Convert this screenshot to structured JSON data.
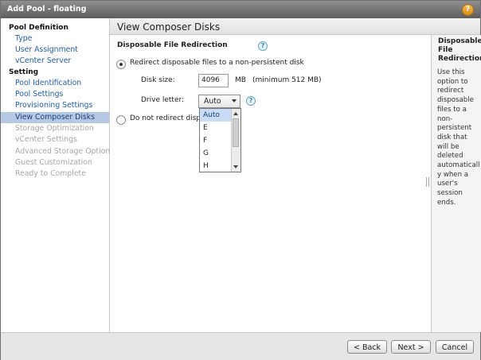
{
  "window": {
    "title": "Add Pool - floating",
    "help_glyph": "?"
  },
  "sidebar": {
    "sections": [
      {
        "heading": "Pool Definition",
        "items": [
          {
            "label": "Type",
            "state": "link"
          },
          {
            "label": "User Assignment",
            "state": "link"
          },
          {
            "label": "vCenter Server",
            "state": "link"
          }
        ]
      },
      {
        "heading": "Setting",
        "items": [
          {
            "label": "Pool Identification",
            "state": "link"
          },
          {
            "label": "Pool Settings",
            "state": "link"
          },
          {
            "label": "Provisioning Settings",
            "state": "link"
          },
          {
            "label": "View Composer Disks",
            "state": "selected"
          },
          {
            "label": "Storage Optimization",
            "state": "disabled"
          },
          {
            "label": "vCenter Settings",
            "state": "disabled"
          },
          {
            "label": "Advanced Storage Options",
            "state": "disabled"
          },
          {
            "label": "Guest Customization",
            "state": "disabled"
          },
          {
            "label": "Ready to Complete",
            "state": "disabled"
          }
        ]
      }
    ]
  },
  "main": {
    "page_title": "View Composer Disks",
    "section_heading": "Disposable File Redirection",
    "help_glyph": "?",
    "redirect_option": {
      "label": "Redirect disposable files to a non-persistent disk",
      "selected": true,
      "disk_size_label": "Disk size:",
      "disk_size_value": "4096",
      "disk_size_unit": "MB",
      "disk_size_min": "(minimum 512 MB)",
      "drive_letter_label": "Drive letter:",
      "drive_letter_value": "Auto",
      "drive_letter_options": [
        "Auto",
        "E",
        "F",
        "G",
        "H"
      ]
    },
    "no_redirect_option": {
      "label": "Do not redirect disposable files",
      "visible_label": "Do not redirect dispo",
      "selected": false
    }
  },
  "help_panel": {
    "title": "Disposable File Redirection",
    "body": "Use this option to redirect disposable files to a non-persistent disk that will be deleted automatically when a user's session ends."
  },
  "footer": {
    "back_label": "< Back",
    "next_label": "Next >",
    "cancel_label": "Cancel"
  },
  "colors": {
    "titlebar": "#6e6e6e",
    "link": "#1f5fb3",
    "disabled": "#a8a8a8",
    "selected_nav": "#b5c9e5",
    "help_button": "#e3a02a"
  }
}
